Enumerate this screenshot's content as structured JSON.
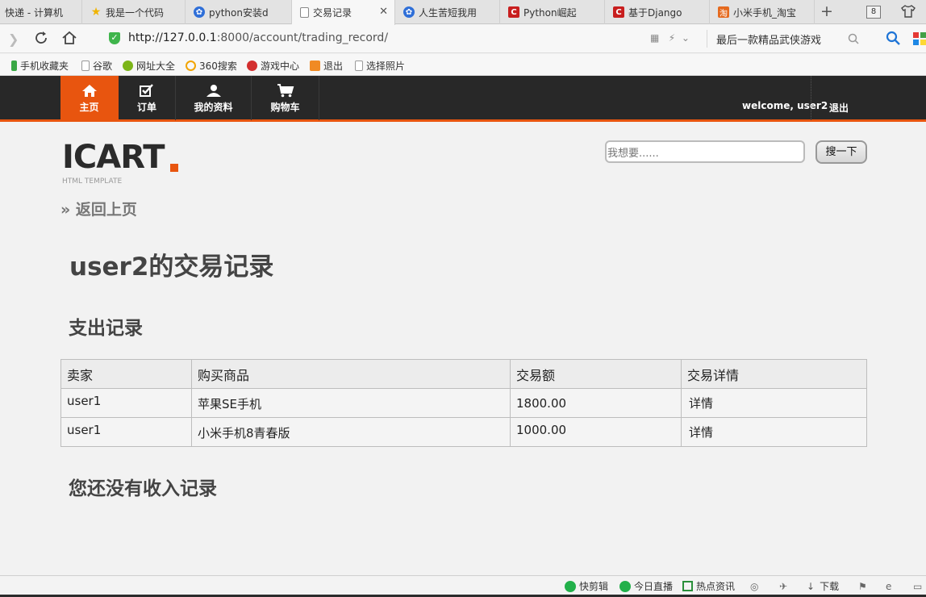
{
  "browser": {
    "tabs": [
      {
        "label": "快递 - 计算机",
        "icon": "page-icon",
        "active": false
      },
      {
        "label": "我是一个代码",
        "icon": "star-icon",
        "active": false
      },
      {
        "label": "python安装d",
        "icon": "paw-icon",
        "active": false
      },
      {
        "label": "交易记录",
        "icon": "page-icon",
        "active": true
      },
      {
        "label": "人生苦短我用",
        "icon": "paw-icon",
        "active": false
      },
      {
        "label": "Python崛起",
        "icon": "c-logo-icon",
        "active": false
      },
      {
        "label": "基于Django",
        "icon": "c-logo-icon",
        "active": false
      },
      {
        "label": "小米手机_淘宝",
        "icon": "shop-icon",
        "active": false
      }
    ],
    "tab_count": "8",
    "url_host": "http://127.0.0.1",
    "url_path": ":8000/account/trading_record/",
    "search_text": "最后一款精品武侠游戏",
    "bookmarks": [
      "手机收藏夹",
      "谷歌",
      "网址大全",
      "360搜索",
      "游戏中心",
      "退出",
      "选择照片"
    ]
  },
  "nav": {
    "items": [
      {
        "label": "主页",
        "icon": "home-icon"
      },
      {
        "label": "订单",
        "icon": "checkbox-icon"
      },
      {
        "label": "我的资料",
        "icon": "user-icon"
      },
      {
        "label": "购物车",
        "icon": "cart-icon"
      }
    ],
    "welcome": "welcome, user2",
    "logout": "退出"
  },
  "header": {
    "logo": "ICART",
    "logo_sub": "HTML TEMPLATE",
    "search_placeholder": "我想要......",
    "search_button": "搜一下"
  },
  "page": {
    "back_link": "» 返回上页",
    "title": "user2的交易记录",
    "expense_heading": "支出记录",
    "columns": [
      "卖家",
      "购买商品",
      "交易额",
      "交易详情"
    ],
    "rows": [
      {
        "seller": "user1",
        "item": "苹果SE手机",
        "amount": "1800.00",
        "details": "详情"
      },
      {
        "seller": "user1",
        "item": "小米手机8青春版",
        "amount": "1000.00",
        "details": "详情"
      }
    ],
    "income_heading": "您还没有收入记录"
  },
  "statusbar": {
    "items": [
      "快剪辑",
      "今日直播",
      "热点资讯",
      "下载"
    ]
  },
  "colors": {
    "accent": "#e8550f",
    "nav_bg": "#282828"
  }
}
